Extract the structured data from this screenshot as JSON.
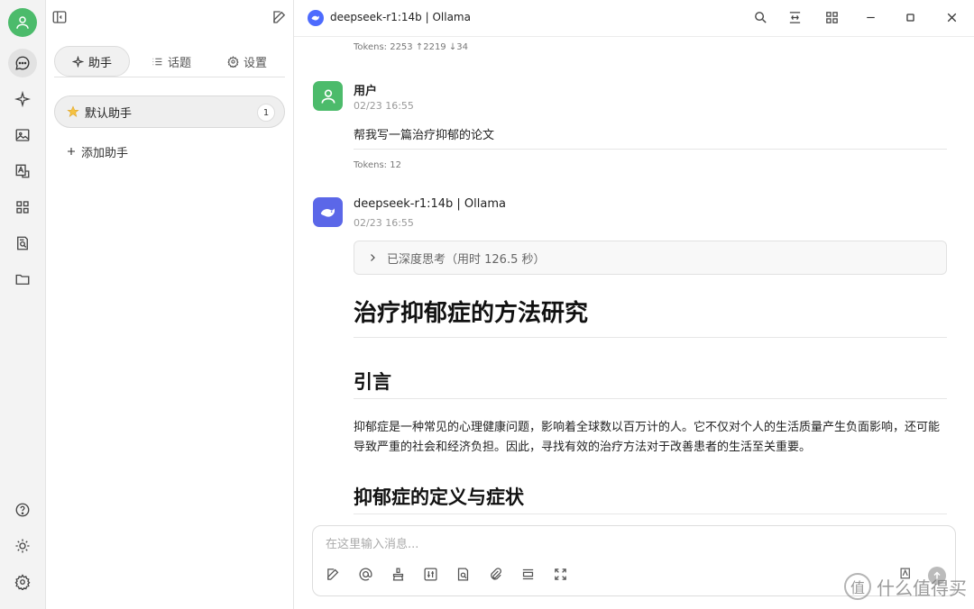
{
  "window": {
    "title": "deepseek-r1:14b | Ollama"
  },
  "panel": {
    "tabs": [
      {
        "label": "助手"
      },
      {
        "label": "话题"
      },
      {
        "label": "设置"
      }
    ],
    "assistant": {
      "name": "默认助手",
      "count": "1"
    },
    "add_assistant": "添加助手"
  },
  "chat": {
    "prev_tokens": "Tokens: 2253 ↑2219 ↓34",
    "user_message": {
      "name": "用户",
      "time": "02/23 16:55",
      "text": "帮我写一篇治疗抑郁的论文",
      "tokens": "Tokens: 12"
    },
    "assistant_message": {
      "name": "deepseek-r1:14b | Ollama",
      "time": "02/23 16:55",
      "thinking": "已深度思考（用时 126.5 秒）",
      "heading1": "治疗抑郁症的方法研究",
      "section1_title": "引言",
      "section1_text": "抑郁症是一种常见的心理健康问题，影响着全球数以百万计的人。它不仅对个人的生活质量产生负面影响，还可能导致严重的社会和经济负担。因此，寻找有效的治疗方法对于改善患者的生活至关重要。",
      "section2_title": "抑郁症的定义与症状"
    }
  },
  "composer": {
    "placeholder": "在这里输入消息..."
  },
  "watermark": {
    "text": "什么值得买",
    "symbol": "值"
  },
  "colors": {
    "user_avatar": "#4cbb6b",
    "brand_blue": "#4d6bfe",
    "model_avatar": "#5b67e8"
  }
}
